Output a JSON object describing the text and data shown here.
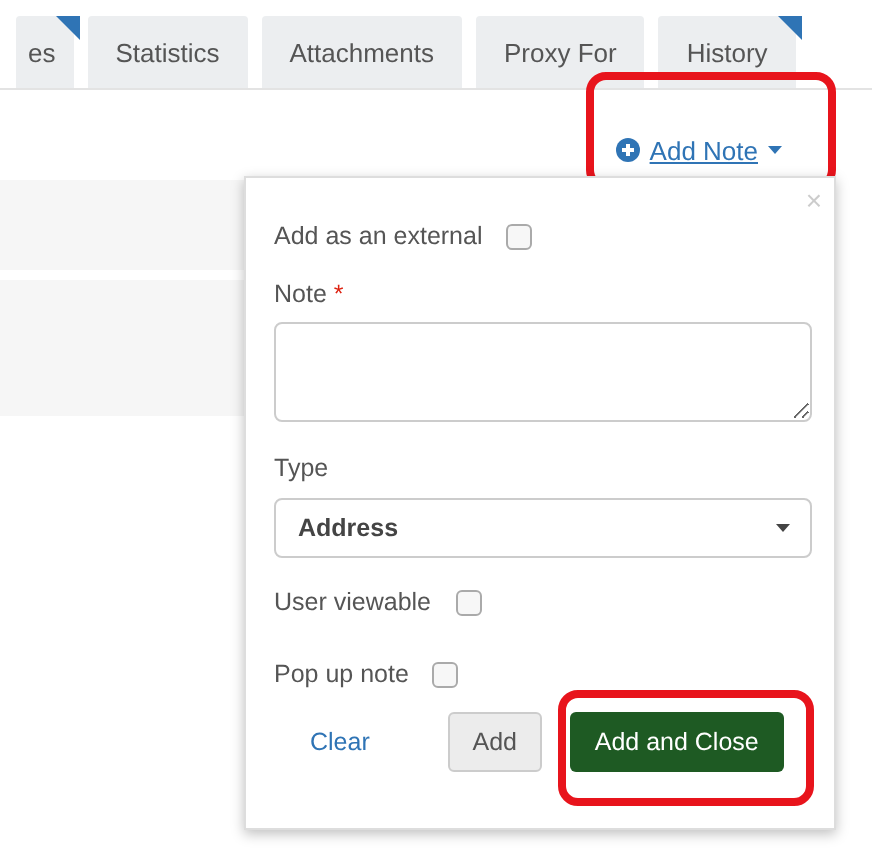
{
  "tabs": [
    {
      "label": "es",
      "selected": false,
      "flagged": true
    },
    {
      "label": "Statistics",
      "selected": false,
      "flagged": false
    },
    {
      "label": "Attachments",
      "selected": false,
      "flagged": false
    },
    {
      "label": "Proxy For",
      "selected": false,
      "flagged": false
    },
    {
      "label": "History",
      "selected": false,
      "flagged": true
    }
  ],
  "add_note_link": {
    "label": "Add Note",
    "highlighted": true
  },
  "popup": {
    "close": "×",
    "fields": [
      {
        "kind": "checkbox",
        "label": "Add as an external",
        "checked": false
      },
      {
        "kind": "textarea",
        "label": "Note",
        "required_mark": "*"
      },
      {
        "kind": "select",
        "label": "Type",
        "value": "Address"
      },
      {
        "kind": "checkbox",
        "label": "User viewable",
        "checked": false
      },
      {
        "kind": "checkbox",
        "label": "Pop up note",
        "checked": false
      }
    ],
    "buttons": [
      {
        "kind": "link",
        "label": "Clear"
      },
      {
        "kind": "secondary",
        "label": "Add"
      },
      {
        "kind": "primary",
        "label": "Add and Close",
        "highlighted": true
      }
    ]
  }
}
